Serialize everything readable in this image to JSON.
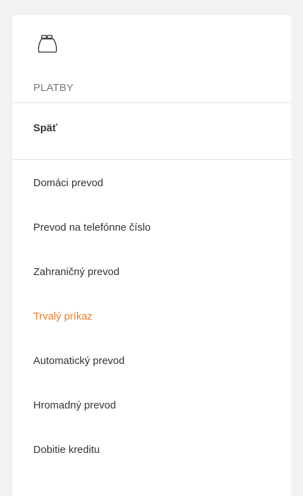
{
  "header": {
    "icon": "purse-icon",
    "title": "PLATBY"
  },
  "back": {
    "label": "Späť"
  },
  "menu": {
    "items": [
      {
        "label": "Domáci prevod",
        "active": false
      },
      {
        "label": "Prevod na telefónne číslo",
        "active": false
      },
      {
        "label": "Zahraničný prevod",
        "active": false
      },
      {
        "label": "Trvalý príkaz",
        "active": true
      },
      {
        "label": "Automatický prevod",
        "active": false
      },
      {
        "label": "Hromadný prevod",
        "active": false
      },
      {
        "label": "Dobitie kreditu",
        "active": false
      }
    ]
  },
  "colors": {
    "active": "#ee7a29",
    "text": "#333333",
    "muted": "#777777",
    "background": "#f2f2f2",
    "panel": "#ffffff"
  }
}
